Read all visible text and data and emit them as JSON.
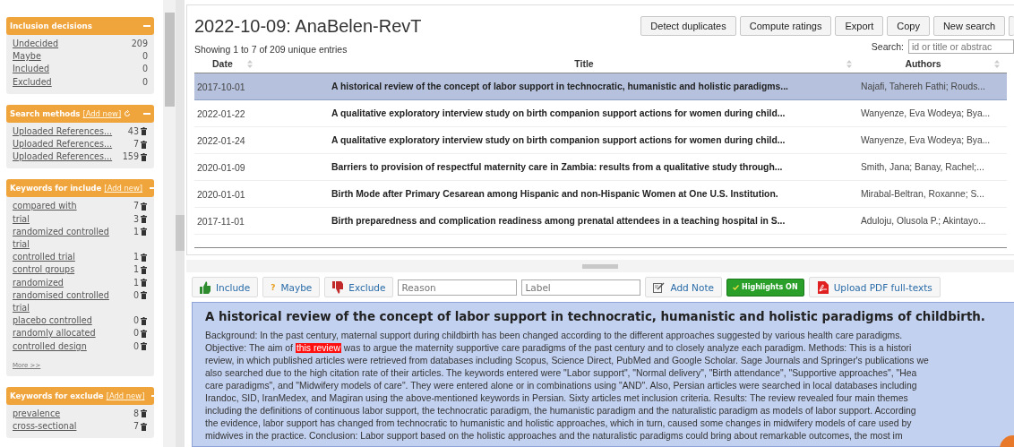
{
  "sidebar": {
    "panels": [
      {
        "kind": "counts",
        "title": "Inclusion decisions",
        "items": [
          {
            "label": "Undecided",
            "count": "209"
          },
          {
            "label": "Maybe",
            "count": "0"
          },
          {
            "label": "Included",
            "count": "0"
          },
          {
            "label": "Excluded",
            "count": "0"
          }
        ]
      },
      {
        "kind": "keywords",
        "title": "Search methods",
        "add_new": "[Add new]",
        "refresh": true,
        "items": [
          {
            "label": "Uploaded References...",
            "count": "43"
          },
          {
            "label": "Uploaded References...",
            "count": "7"
          },
          {
            "label": "Uploaded References...",
            "count": "159"
          }
        ]
      },
      {
        "kind": "keywords",
        "title": "Keywords for include",
        "add_new": "[Add new]",
        "refresh": false,
        "items": [
          {
            "label": "compared with",
            "count": "7"
          },
          {
            "label": "trial",
            "count": "3"
          },
          {
            "label": "randomized controlled trial",
            "count": "1"
          },
          {
            "label": "controlled trial",
            "count": "1"
          },
          {
            "label": "control groups",
            "count": "1"
          },
          {
            "label": "randomized",
            "count": "1"
          },
          {
            "label": "randomised controlled trial",
            "count": "0"
          },
          {
            "label": "placebo controlled",
            "count": "0"
          },
          {
            "label": "randomly allocated",
            "count": "0"
          },
          {
            "label": "controlled design",
            "count": "0"
          }
        ],
        "more": "More >>"
      },
      {
        "kind": "keywords",
        "title": "Keywords for exclude",
        "add_new": "[Add new]",
        "refresh": false,
        "items": [
          {
            "label": "prevalence",
            "count": "8"
          },
          {
            "label": "cross-sectional",
            "count": "7"
          }
        ]
      }
    ]
  },
  "review": {
    "title": "2022-10-09: AnaBelen-RevT",
    "buttons": [
      "Detect duplicates",
      "Compute ratings",
      "Export",
      "Copy",
      "New search"
    ],
    "summary": "Showing 1 to 7 of 209 unique entries",
    "search_label": "Search:",
    "search_placeholder": "id or title or abstrac",
    "table": {
      "columns": [
        "Date",
        "Title",
        "Authors"
      ],
      "rows": [
        {
          "date": "2017-10-01",
          "title": "A historical review of the concept of labor support in technocratic, humanistic and holistic paradigms...",
          "authors": "Najafi, Tahereh Fathi; Rouds...",
          "selected": true
        },
        {
          "date": "2022-01-22",
          "title": "A qualitative exploratory interview study on birth companion support actions for women during child...",
          "authors": "Wanyenze, Eva Wodeya; Bya...",
          "selected": false
        },
        {
          "date": "2022-01-24",
          "title": "A qualitative exploratory interview study on birth companion support actions for women during child...",
          "authors": "Wanyenze, Eva Wodeya; Bya...",
          "selected": false
        },
        {
          "date": "2020-01-09",
          "title": "Barriers to provision of respectful maternity care in Zambia: results from a qualitative study through...",
          "authors": "Smith, Jana; Banay, Rachel;...",
          "selected": false
        },
        {
          "date": "2020-01-01",
          "title": "Birth Mode after Primary Cesarean among Hispanic and non-Hispanic Women at One U.S. Institution.",
          "authors": "Mirabal-Beltran, Roxanne; S...",
          "selected": false
        },
        {
          "date": "2017-11-01",
          "title": "Birth preparedness and complication readiness among prenatal attendees in a teaching hospital in S...",
          "authors": "Aduloju, Olusola P.; Akintayo...",
          "selected": false
        }
      ]
    }
  },
  "toolbar": {
    "include": "Include",
    "maybe_icon": "?",
    "maybe": "Maybe",
    "exclude": "Exclude",
    "reason_placeholder": "Reason",
    "label_placeholder": "Label",
    "add_note": "Add Note",
    "highlights": {
      "label": "Highlights ON",
      "on": true
    },
    "upload": "Upload PDF full-texts"
  },
  "abstract": {
    "title": "A historical review of the concept of labor support in technocratic, humanistic and holistic paradigms of childbirth.",
    "lines": [
      [
        {
          "text": "Background: In the past century, maternal support during childbirth has been changed according to the different approaches suggested by various health care paradigms.",
          "highlighted": false
        }
      ],
      [
        {
          "text": "Objective: The aim of ",
          "highlighted": false
        },
        {
          "text": "this review",
          "highlighted": true
        },
        {
          "text": " was to argue the maternity supportive care paradigms of the past century and to closely analyze each paradigm. Methods: This is a histori",
          "highlighted": false
        }
      ],
      [
        {
          "text": "review, in which published articles were retrieved from databases including Scopus, Science Direct, PubMed and Google Scholar. Sage Journals and Springer's publications we",
          "highlighted": false
        }
      ],
      [
        {
          "text": "also searched due to the high citation rate of their articles. The keywords entered were \"Labor support\", \"Normal delivery\", \"Birth attendance\", \"Supportive approaches\", \"Hea",
          "highlighted": false
        }
      ],
      [
        {
          "text": "care paradigms\", and \"Midwifery models of care\". They were entered alone or in combinations using \"AND\". Also, Persian articles were searched in local databases including",
          "highlighted": false
        }
      ],
      [
        {
          "text": "Irandoc, SID, IranMedex, and Magiran using the above-mentioned keywords in Persian. Sixty articles met inclusion criteria. Results: The review revealed four main themes",
          "highlighted": false
        }
      ],
      [
        {
          "text": "including the definitions of continuous labor support, the technocratic paradigm, the humanistic paradigm and the naturalistic paradigm as models of labor support. According",
          "highlighted": false
        }
      ],
      [
        {
          "text": "the evidence, labor support has changed from technocratic to humanistic and holistic approaches, which in turn, caused some changes in midwifery models of care used by",
          "highlighted": false
        }
      ],
      [
        {
          "text": "midwives in the practice. Conclusion: Labor support based on the holistic approaches and the naturalistic paradigms could bring about remarkable outcomes, the most im",
          "highlighted": false
        }
      ]
    ]
  }
}
